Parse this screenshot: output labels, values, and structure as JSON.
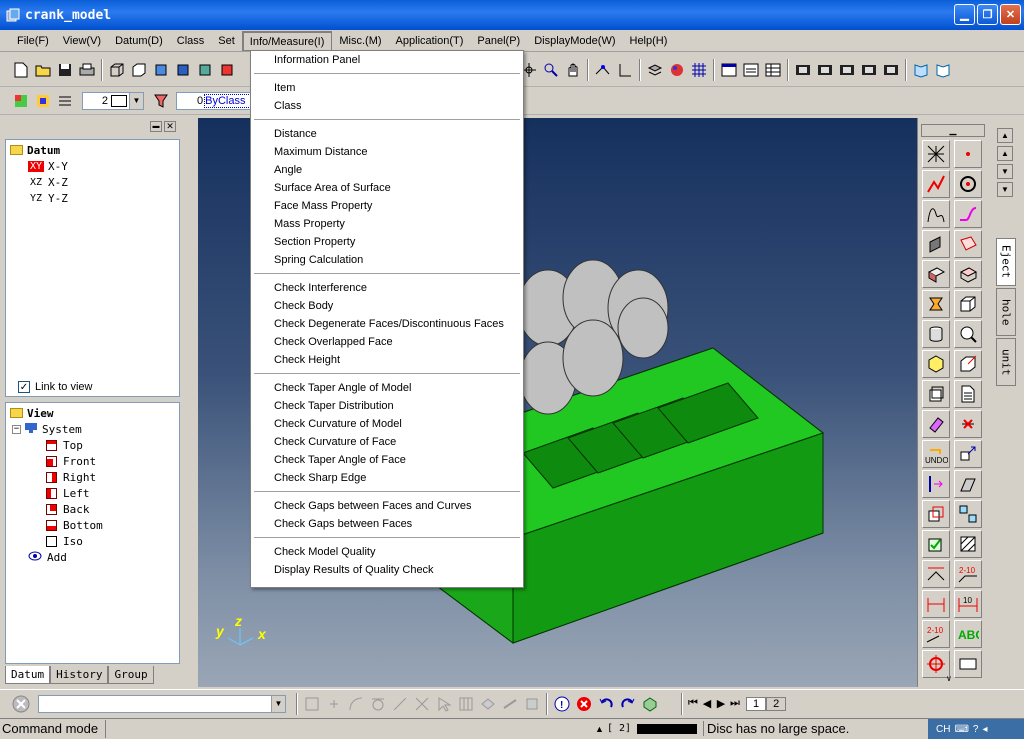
{
  "window": {
    "title": "crank_model"
  },
  "menubar": {
    "items": [
      {
        "label": "File(F)"
      },
      {
        "label": "View(V)"
      },
      {
        "label": "Datum(D)"
      },
      {
        "label": "Class"
      },
      {
        "label": "Set"
      },
      {
        "label": "Info/Measure(I)"
      },
      {
        "label": "Misc.(M)"
      },
      {
        "label": "Application(T)"
      },
      {
        "label": "Panel(P)"
      },
      {
        "label": "DisplayMode(W)"
      },
      {
        "label": "Help(H)"
      }
    ]
  },
  "toolbar2": {
    "line_width": "2",
    "layer": "0",
    "class_value": "ByClass"
  },
  "datum_tree": {
    "title": "Datum",
    "items": [
      {
        "tag": "XY",
        "label": "X-Y"
      },
      {
        "tag": "XZ",
        "label": "X-Z"
      },
      {
        "tag": "YZ",
        "label": "Y-Z"
      }
    ]
  },
  "link_to_view": {
    "label": "Link to view",
    "checked": true
  },
  "view_tree": {
    "title": "View",
    "system": "System",
    "views": [
      {
        "label": "Top"
      },
      {
        "label": "Front"
      },
      {
        "label": "Right"
      },
      {
        "label": "Left"
      },
      {
        "label": "Back"
      },
      {
        "label": "Bottom"
      },
      {
        "label": "Iso"
      }
    ],
    "add": "Add"
  },
  "left_tabs": [
    {
      "label": "Datum"
    },
    {
      "label": "History"
    },
    {
      "label": "Group"
    }
  ],
  "right_tabs": [
    {
      "label": "Eject"
    },
    {
      "label": "hole"
    },
    {
      "label": "unit"
    }
  ],
  "axis": {
    "y": "y",
    "z": "z",
    "x": "x"
  },
  "dropdown": {
    "groups": [
      [
        "Information Panel"
      ],
      [
        "Item",
        "Class"
      ],
      [
        "Distance",
        "Maximum Distance",
        "Angle",
        "Surface Area of Surface",
        "Face Mass Property",
        "Mass Property",
        "Section Property",
        "Spring Calculation"
      ],
      [
        "Check Interference",
        "Check Body",
        "Check Degenerate Faces/Discontinuous Faces",
        "Check Overlapped Face",
        "Check Height"
      ],
      [
        "Check Taper Angle of Model",
        "Check Taper Distribution",
        "Check Curvature of Model",
        "Check Curvature of Face",
        "Check Taper Angle of Face",
        "Check Sharp Edge"
      ],
      [
        "Check Gaps between Faces and Curves",
        "Check Gaps between Faces"
      ],
      [
        "Check Model Quality",
        "Display Results of Quality Check"
      ]
    ]
  },
  "bottom": {
    "pages": [
      "1",
      "2"
    ]
  },
  "status": {
    "mode": "Command mode",
    "coord": "[ 2]",
    "message": "Disc has no large space.",
    "ime": "CH"
  },
  "colors": {
    "model_green": "#19b219",
    "accent_blue": "#0a5fd8"
  }
}
